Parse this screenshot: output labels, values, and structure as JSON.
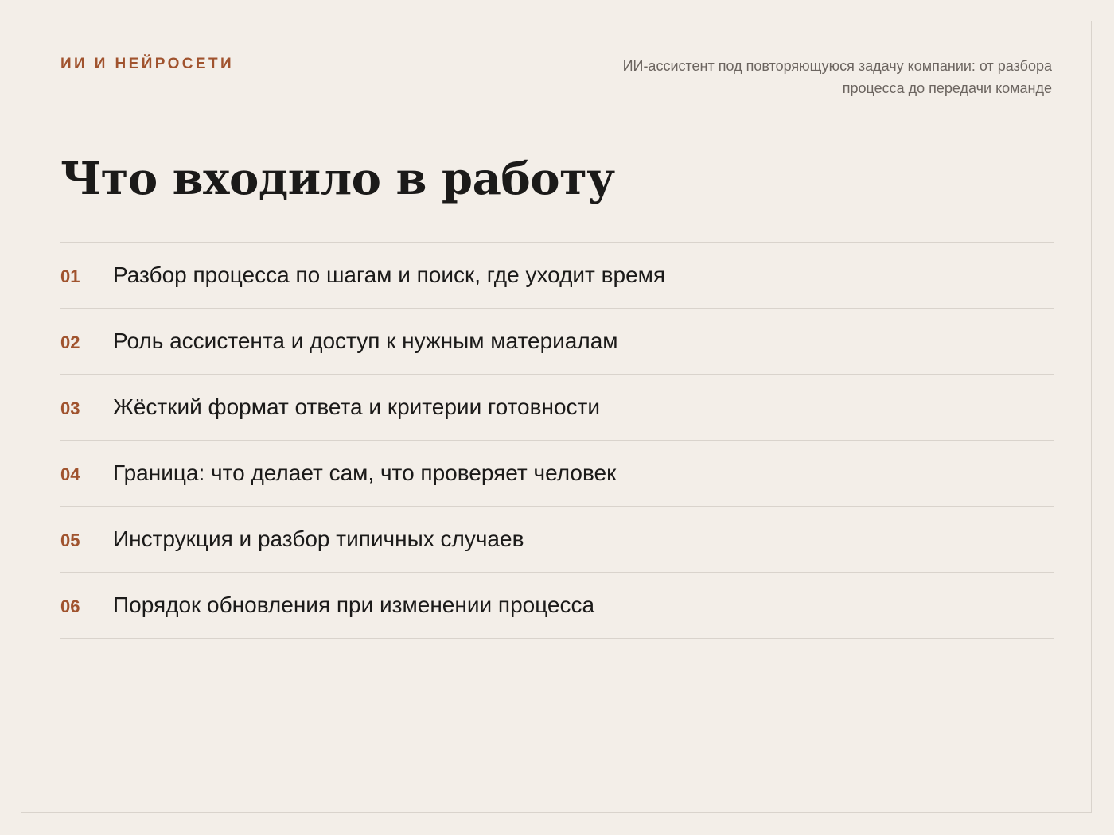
{
  "header": {
    "category": "ИИ И НЕЙРОСЕТИ",
    "subtitle": "ИИ-ассистент под повторяющуюся задачу компании: от разбора процесса до передачи команде"
  },
  "title": "Что входило в работу",
  "items": [
    {
      "num": "01",
      "text": "Разбор процесса по шагам и поиск, где уходит время"
    },
    {
      "num": "02",
      "text": "Роль ассистента и доступ к нужным материалам"
    },
    {
      "num": "03",
      "text": "Жёсткий формат ответа и критерии готовности"
    },
    {
      "num": "04",
      "text": "Граница: что делает сам, что проверяет человек"
    },
    {
      "num": "05",
      "text": "Инструкция и разбор типичных случаев"
    },
    {
      "num": "06",
      "text": "Порядок обновления при изменении процесса"
    }
  ],
  "colors": {
    "background": "#f3eee8",
    "accent": "#a0532e",
    "text": "#1b1a19",
    "muted": "#6c6560",
    "divider": "#d9d3cc"
  }
}
